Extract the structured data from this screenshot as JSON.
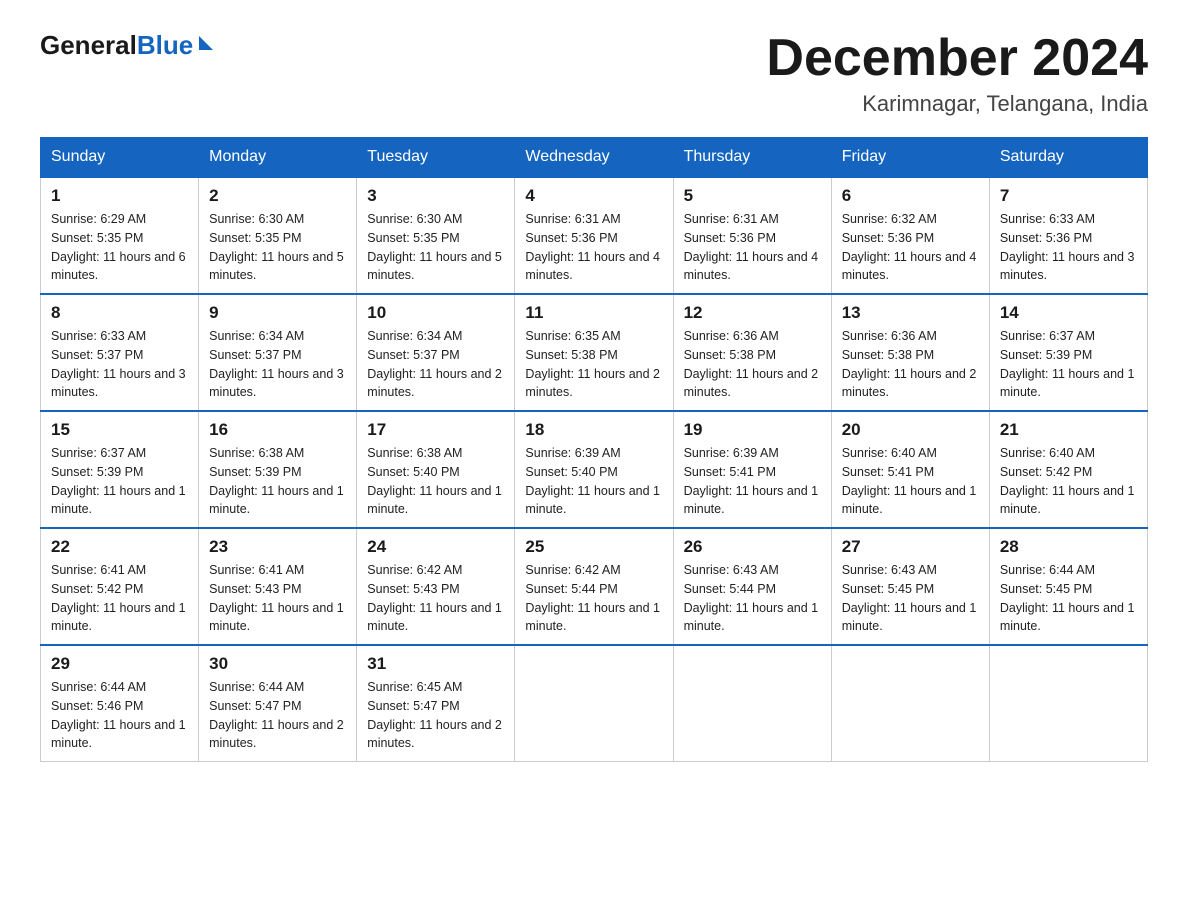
{
  "header": {
    "logo_general": "General",
    "logo_blue": "Blue",
    "title": "December 2024",
    "subtitle": "Karimnagar, Telangana, India"
  },
  "weekdays": [
    "Sunday",
    "Monday",
    "Tuesday",
    "Wednesday",
    "Thursday",
    "Friday",
    "Saturday"
  ],
  "weeks": [
    [
      {
        "day": "1",
        "sunrise": "6:29 AM",
        "sunset": "5:35 PM",
        "daylight": "11 hours and 6 minutes."
      },
      {
        "day": "2",
        "sunrise": "6:30 AM",
        "sunset": "5:35 PM",
        "daylight": "11 hours and 5 minutes."
      },
      {
        "day": "3",
        "sunrise": "6:30 AM",
        "sunset": "5:35 PM",
        "daylight": "11 hours and 5 minutes."
      },
      {
        "day": "4",
        "sunrise": "6:31 AM",
        "sunset": "5:36 PM",
        "daylight": "11 hours and 4 minutes."
      },
      {
        "day": "5",
        "sunrise": "6:31 AM",
        "sunset": "5:36 PM",
        "daylight": "11 hours and 4 minutes."
      },
      {
        "day": "6",
        "sunrise": "6:32 AM",
        "sunset": "5:36 PM",
        "daylight": "11 hours and 4 minutes."
      },
      {
        "day": "7",
        "sunrise": "6:33 AM",
        "sunset": "5:36 PM",
        "daylight": "11 hours and 3 minutes."
      }
    ],
    [
      {
        "day": "8",
        "sunrise": "6:33 AM",
        "sunset": "5:37 PM",
        "daylight": "11 hours and 3 minutes."
      },
      {
        "day": "9",
        "sunrise": "6:34 AM",
        "sunset": "5:37 PM",
        "daylight": "11 hours and 3 minutes."
      },
      {
        "day": "10",
        "sunrise": "6:34 AM",
        "sunset": "5:37 PM",
        "daylight": "11 hours and 2 minutes."
      },
      {
        "day": "11",
        "sunrise": "6:35 AM",
        "sunset": "5:38 PM",
        "daylight": "11 hours and 2 minutes."
      },
      {
        "day": "12",
        "sunrise": "6:36 AM",
        "sunset": "5:38 PM",
        "daylight": "11 hours and 2 minutes."
      },
      {
        "day": "13",
        "sunrise": "6:36 AM",
        "sunset": "5:38 PM",
        "daylight": "11 hours and 2 minutes."
      },
      {
        "day": "14",
        "sunrise": "6:37 AM",
        "sunset": "5:39 PM",
        "daylight": "11 hours and 1 minute."
      }
    ],
    [
      {
        "day": "15",
        "sunrise": "6:37 AM",
        "sunset": "5:39 PM",
        "daylight": "11 hours and 1 minute."
      },
      {
        "day": "16",
        "sunrise": "6:38 AM",
        "sunset": "5:39 PM",
        "daylight": "11 hours and 1 minute."
      },
      {
        "day": "17",
        "sunrise": "6:38 AM",
        "sunset": "5:40 PM",
        "daylight": "11 hours and 1 minute."
      },
      {
        "day": "18",
        "sunrise": "6:39 AM",
        "sunset": "5:40 PM",
        "daylight": "11 hours and 1 minute."
      },
      {
        "day": "19",
        "sunrise": "6:39 AM",
        "sunset": "5:41 PM",
        "daylight": "11 hours and 1 minute."
      },
      {
        "day": "20",
        "sunrise": "6:40 AM",
        "sunset": "5:41 PM",
        "daylight": "11 hours and 1 minute."
      },
      {
        "day": "21",
        "sunrise": "6:40 AM",
        "sunset": "5:42 PM",
        "daylight": "11 hours and 1 minute."
      }
    ],
    [
      {
        "day": "22",
        "sunrise": "6:41 AM",
        "sunset": "5:42 PM",
        "daylight": "11 hours and 1 minute."
      },
      {
        "day": "23",
        "sunrise": "6:41 AM",
        "sunset": "5:43 PM",
        "daylight": "11 hours and 1 minute."
      },
      {
        "day": "24",
        "sunrise": "6:42 AM",
        "sunset": "5:43 PM",
        "daylight": "11 hours and 1 minute."
      },
      {
        "day": "25",
        "sunrise": "6:42 AM",
        "sunset": "5:44 PM",
        "daylight": "11 hours and 1 minute."
      },
      {
        "day": "26",
        "sunrise": "6:43 AM",
        "sunset": "5:44 PM",
        "daylight": "11 hours and 1 minute."
      },
      {
        "day": "27",
        "sunrise": "6:43 AM",
        "sunset": "5:45 PM",
        "daylight": "11 hours and 1 minute."
      },
      {
        "day": "28",
        "sunrise": "6:44 AM",
        "sunset": "5:45 PM",
        "daylight": "11 hours and 1 minute."
      }
    ],
    [
      {
        "day": "29",
        "sunrise": "6:44 AM",
        "sunset": "5:46 PM",
        "daylight": "11 hours and 1 minute."
      },
      {
        "day": "30",
        "sunrise": "6:44 AM",
        "sunset": "5:47 PM",
        "daylight": "11 hours and 2 minutes."
      },
      {
        "day": "31",
        "sunrise": "6:45 AM",
        "sunset": "5:47 PM",
        "daylight": "11 hours and 2 minutes."
      },
      null,
      null,
      null,
      null
    ]
  ]
}
